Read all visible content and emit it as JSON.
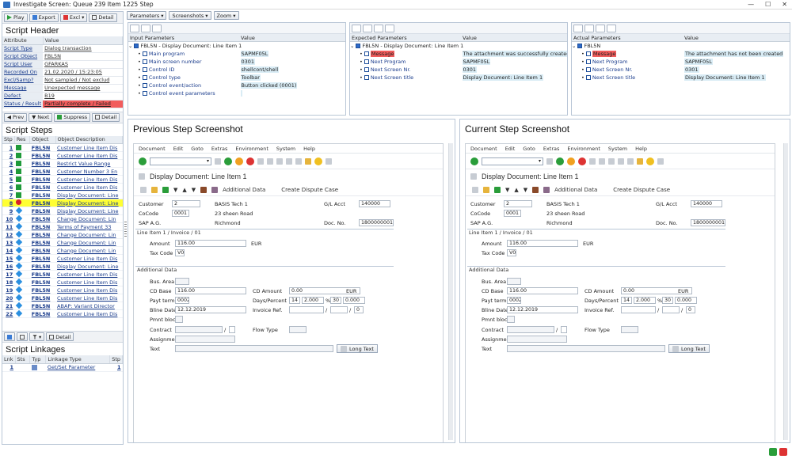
{
  "window": {
    "title": "Investigate Screen: Queue 239 Item 1225 Step"
  },
  "left": {
    "toolbar": {
      "play": "Play",
      "export": "Export",
      "excl": "Excl",
      "detail": "Detail"
    },
    "script_header": {
      "title": "Script Header",
      "col_attr": "Attribute",
      "col_value": "Value",
      "rows": [
        {
          "a": "Script Type",
          "v": "Dialog transaction"
        },
        {
          "a": "Script Object",
          "v": "FBL5N"
        },
        {
          "a": "Script User",
          "v": "GFARKAS"
        },
        {
          "a": "Recorded On",
          "v": "21.02.2020 / 15:23:05"
        },
        {
          "a": "Excl/Samp?",
          "v": "Not sampled / Not exclud"
        },
        {
          "a": "Message",
          "v": "Unexpected message"
        },
        {
          "a": "Defect",
          "v": "B19"
        },
        {
          "a": "Status / Result",
          "v": "Partially complete / Failed"
        }
      ]
    },
    "steps_toolbar": {
      "prev": "Prev",
      "next": "Next",
      "suppress": "Suppress",
      "detail": "Detail"
    },
    "script_steps": {
      "title": "Script Steps",
      "cols": [
        "Stp",
        "Res",
        "Object",
        "Object Description"
      ],
      "rows": [
        {
          "n": "1",
          "r": "g",
          "o": "FBL5N",
          "d": "Customer Line Item Dis"
        },
        {
          "n": "2",
          "r": "g",
          "o": "FBL5N",
          "d": "Customer Line Item Dis"
        },
        {
          "n": "3",
          "r": "g",
          "o": "FBL5N",
          "d": "Restrict Value Range"
        },
        {
          "n": "4",
          "r": "g",
          "o": "FBL5N",
          "d": "Customer Number 3 En"
        },
        {
          "n": "5",
          "r": "g",
          "o": "FBL5N",
          "d": "Customer Line Item Dis"
        },
        {
          "n": "6",
          "r": "g",
          "o": "FBL5N",
          "d": "Customer Line Item Dis"
        },
        {
          "n": "7",
          "r": "g",
          "o": "FBL5N",
          "d": "Display Document: Line"
        },
        {
          "n": "8",
          "r": "r",
          "o": "FBL5N",
          "d": "Display Document: Line"
        },
        {
          "n": "9",
          "r": "b",
          "o": "FBL5N",
          "d": "Display Document: Line"
        },
        {
          "n": "10",
          "r": "b",
          "o": "FBL5N",
          "d": "Change Document: Lin"
        },
        {
          "n": "11",
          "r": "b",
          "o": "FBL5N",
          "d": "Terms of Payment 33"
        },
        {
          "n": "12",
          "r": "b",
          "o": "FBL5N",
          "d": "Change Document: Lin"
        },
        {
          "n": "13",
          "r": "b",
          "o": "FBL5N",
          "d": "Change Document: Lin"
        },
        {
          "n": "14",
          "r": "b",
          "o": "FBL5N",
          "d": "Change Document: Lin"
        },
        {
          "n": "15",
          "r": "b",
          "o": "FBL5N",
          "d": "Customer Line Item Dis"
        },
        {
          "n": "16",
          "r": "b",
          "o": "FBL5N",
          "d": "Display Document: Line"
        },
        {
          "n": "17",
          "r": "b",
          "o": "FBL5N",
          "d": "Customer Line Item Dis"
        },
        {
          "n": "18",
          "r": "b",
          "o": "FBL5N",
          "d": "Customer Line Item Dis"
        },
        {
          "n": "19",
          "r": "b",
          "o": "FBL5N",
          "d": "Customer Line Item Dis"
        },
        {
          "n": "20",
          "r": "b",
          "o": "FBL5N",
          "d": "Customer Line Item Dis"
        },
        {
          "n": "21",
          "r": "b",
          "o": "FBL5N",
          "d": "ABAP: Variant Director"
        },
        {
          "n": "22",
          "r": "b",
          "o": "FBL5N",
          "d": "Customer Line Item Dis"
        }
      ]
    },
    "linkage_toolbar": {
      "detail": "Detail"
    },
    "script_linkages": {
      "title": "Script Linkages",
      "cols": [
        "Lnk",
        "Sts",
        "Typ",
        "Linkage Type",
        "Stp"
      ],
      "rows": [
        {
          "lnk": "1",
          "type": "Get/Set Parameter",
          "stp": "1"
        }
      ]
    }
  },
  "top_toolbar": {
    "parameters": "Parameters",
    "screenshots": "Screenshots",
    "zoom": "Zoom"
  },
  "input_params": {
    "col1": "Input Parameters",
    "col2": "Value",
    "root": "FBL5N - Display Document: Line Item 1",
    "rows": [
      {
        "k": "Main program",
        "v": "SAPMF05L"
      },
      {
        "k": "Main screen number",
        "v": "0301"
      },
      {
        "k": "Control ID",
        "v": "shellcont/shell"
      },
      {
        "k": "Control type",
        "v": "Toolbar"
      },
      {
        "k": "Control event/action",
        "v": "Button clicked (0001)"
      },
      {
        "k": "Control event parameters",
        "v": ""
      }
    ]
  },
  "expected_params": {
    "col1": "Expected Parameters",
    "col2": "Value",
    "root": "FBL5N - Display Document: Line Item 1",
    "rows": [
      {
        "k": "Message",
        "v": "The attachment was successfully created"
      },
      {
        "k": "Next Program",
        "v": "SAPMF05L"
      },
      {
        "k": "Next Screen Nr.",
        "v": "0301"
      },
      {
        "k": "Next Screen title",
        "v": "Display Document: Line Item 1"
      }
    ]
  },
  "actual_params": {
    "col1": "Actual Parameters",
    "col2": "Value",
    "root": "FBL5N",
    "rows": [
      {
        "k": "Message",
        "v": "The attachment has not been created"
      },
      {
        "k": "Next Program",
        "v": "SAPMF05L"
      },
      {
        "k": "Next Screen Nr.",
        "v": "0301"
      },
      {
        "k": "Next Screen title",
        "v": "Display Document: Line Item 1"
      }
    ]
  },
  "shots": {
    "prev_title": "Previous Step Screenshot",
    "curr_title": "Current Step Screenshot",
    "menu": [
      "Document",
      "Edit",
      "Goto",
      "Extras",
      "Environment",
      "System",
      "Help"
    ],
    "screen_title": "Display Document: Line Item 1",
    "additional_data": "Additional Data",
    "create_dispute": "Create Dispute Case",
    "customer_label": "Customer",
    "customer_val": "2",
    "customer_name": "BASIS Tech 1",
    "street": "23 sheen Road",
    "city": "Richmond",
    "cocode_label": "CoCode",
    "cocode_val": "0001",
    "sap_ag": "SAP A.G.",
    "gl_label": "G/L Acct",
    "gl_val": "140000",
    "doc_label": "Doc. No.",
    "doc_val": "1800000001",
    "group1": "Line Item 1 / Invoice / 01",
    "amount_label": "Amount",
    "amount_val": "116.00",
    "amount_cur": "EUR",
    "tax_label": "Tax Code",
    "tax_val": "V0",
    "group2": "Additional Data",
    "busarea": "Bus. Area",
    "cdbase": "CD Base",
    "cdbase_val": "116.00",
    "cdamount": "CD Amount",
    "cdamount_val": "0.00",
    "cdamount_cur": "EUR",
    "payt": "Payt terms",
    "payt_val": "0002",
    "days": "Days/Percent",
    "d1": "14",
    "p1": "2.000",
    "pct": "%",
    "d2": "30",
    "p2": "0.000",
    "d3": "0",
    "bline": "Bline Date",
    "bline_val": "12.12.2019",
    "invref": "Invoice Ref.",
    "slash": "/",
    "inv_last": "0",
    "pmnt": "Pmnt block",
    "contract": "Contract",
    "flow": "Flow Type",
    "assignment": "Assignment",
    "text": "Text",
    "longtext": "Long Text"
  },
  "colors": {
    "ok": "#1f9a3a",
    "fail": "#f25c5c",
    "accent": "#2d6ac8",
    "highlight": "#ffff33"
  }
}
